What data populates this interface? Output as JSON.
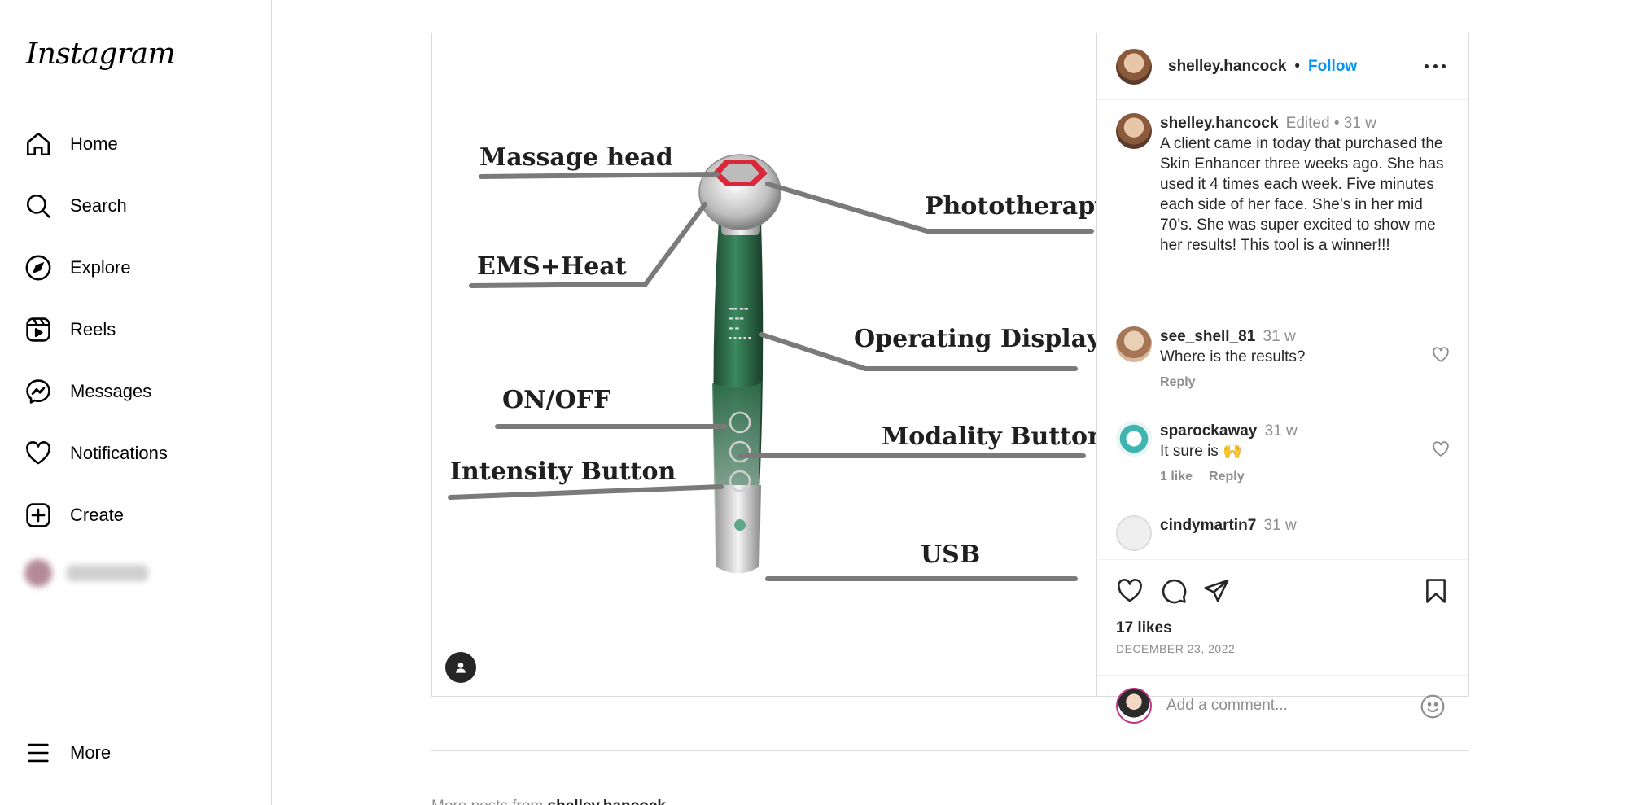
{
  "sidebar": {
    "logo": "Instagram",
    "items": [
      {
        "label": "Home",
        "icon": "home-icon"
      },
      {
        "label": "Search",
        "icon": "search-icon"
      },
      {
        "label": "Explore",
        "icon": "compass-icon"
      },
      {
        "label": "Reels",
        "icon": "reels-icon"
      },
      {
        "label": "Messages",
        "icon": "messenger-icon"
      },
      {
        "label": "Notifications",
        "icon": "heart-icon"
      },
      {
        "label": "Create",
        "icon": "plus-square-icon"
      }
    ],
    "more_label": "More"
  },
  "post": {
    "image_labels": {
      "massage_head": "Massage head",
      "phototherapy": "Phototherapy",
      "ems_heat": "EMS+Heat",
      "operating_display": "Operating Display",
      "on_off": "ON/OFF",
      "modality_button": "Modality Button",
      "intensity_button": "Intensity Button",
      "usb": "USB"
    },
    "header": {
      "username": "shelley.hancock",
      "separator": "•",
      "follow_label": "Follow"
    },
    "caption": {
      "username": "shelley.hancock",
      "meta": "Edited • 31 w",
      "text": "A client came in today that purchased the Skin Enhancer three weeks ago. She has used it 4 times each week. Five minutes each side of her face. She’s in her mid 70’s. She was super excited to show me her results! This tool is a winner!!!"
    },
    "comments": [
      {
        "username": "see_shell_81",
        "time": "31 w",
        "text": "Where is the results?",
        "likes": "",
        "reply": "Reply"
      },
      {
        "username": "sparockaway",
        "time": "31 w",
        "text": "It sure is 🙌",
        "likes": "1 like",
        "reply": "Reply"
      },
      {
        "username": "cindymartin7",
        "time": "31 w",
        "text": "",
        "likes": "",
        "reply": ""
      }
    ],
    "likes": "17 likes",
    "date": "DECEMBER 23, 2022",
    "comment_placeholder": "Add a comment..."
  },
  "more_posts": {
    "prefix": "More posts from",
    "username": "shelley.hancock"
  },
  "colors": {
    "accent": "#0095f6",
    "text": "#262626",
    "muted": "#8e8e8e",
    "border": "#dbdbdb"
  }
}
